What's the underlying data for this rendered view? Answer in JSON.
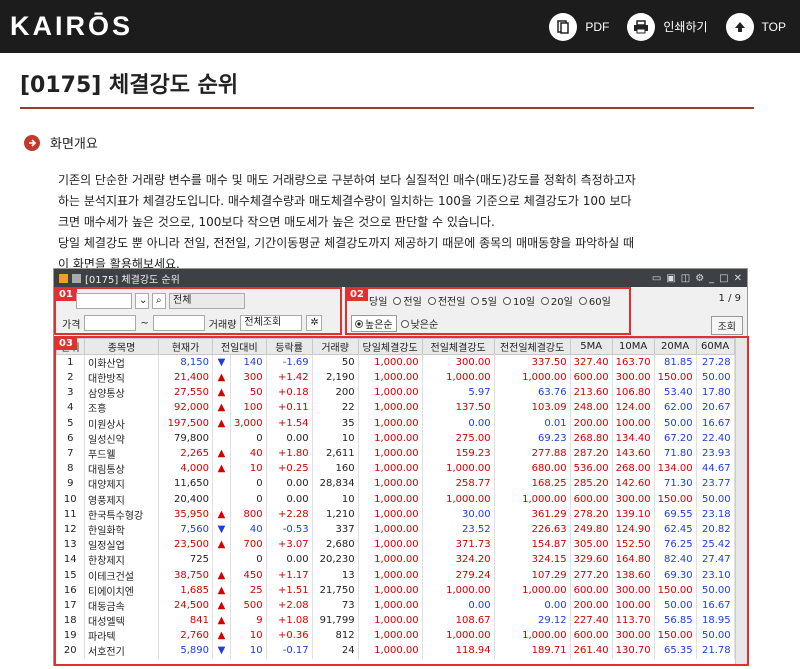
{
  "header": {
    "logo": "KAIRŌS",
    "pdf": "PDF",
    "print": "인쇄하기",
    "top": "TOP"
  },
  "page": {
    "title": "[0175] 체결강도 순위",
    "section": "화면개요",
    "desc": [
      "기존의 단순한 거래량 변수를 매수 및 매도 거래량으로 구분하여 보다 실질적인 매수(매도)강도를 정확히 측정하고자",
      "하는 분석지표가 체결강도입니다. 매수체결수량과 매도체결수량이 일치하는 100을 기준으로 체결강도가 100 보다",
      "크면 매수세가 높은 것으로, 100보다 작으면 매도세가 높은 것으로 판단할 수 있습니다.",
      "당일 체결강도 뿐 아니라 전일, 전전일, 기간이동평균 체결강도까지 제공하기 때문에 종목의 매매동향을 파악하실 때",
      "이 화면을 활용해보세요."
    ]
  },
  "window": {
    "title": "[0175] 체결강도 순위",
    "tags": [
      "01",
      "02",
      "03"
    ],
    "market": "전체",
    "price_label": "가격",
    "volume_label": "거래량",
    "volume_value": "전체조회",
    "radios": [
      "당일",
      "전일",
      "전전일",
      "5일",
      "10일",
      "20일",
      "60일"
    ],
    "sort": [
      "높은순",
      "낮은순"
    ],
    "pager": "1 / 9",
    "query": "조회"
  },
  "table": {
    "headers": [
      "순위",
      "종목명",
      "현재가",
      "전일대비",
      "",
      "등락률",
      "거래량",
      "당일체결강도",
      "전일체결강도",
      "전전일체결강도",
      "5MA",
      "10MA",
      "20MA",
      "60MA"
    ],
    "rows": [
      [
        "1",
        "이화산업",
        "8,150",
        "▼",
        "140",
        "-1.69",
        "50",
        "1,000.00",
        "300.00",
        "337.50",
        "327.40",
        "163.70",
        "81.85",
        "27.28"
      ],
      [
        "2",
        "대한방직",
        "21,400",
        "▲",
        "300",
        "+1.42",
        "2,190",
        "1,000.00",
        "1,000.00",
        "1,000.00",
        "600.00",
        "300.00",
        "150.00",
        "50.00"
      ],
      [
        "3",
        "삼양통상",
        "27,550",
        "▲",
        "50",
        "+0.18",
        "200",
        "1,000.00",
        "5.97",
        "63.76",
        "213.60",
        "106.80",
        "53.40",
        "17.80"
      ],
      [
        "4",
        "조흥",
        "92,000",
        "▲",
        "100",
        "+0.11",
        "22",
        "1,000.00",
        "137.50",
        "103.09",
        "248.00",
        "124.00",
        "62.00",
        "20.67"
      ],
      [
        "5",
        "미원상사",
        "197,500",
        "▲",
        "3,000",
        "+1.54",
        "35",
        "1,000.00",
        "0.00",
        "0.01",
        "200.00",
        "100.00",
        "50.00",
        "16.67"
      ],
      [
        "6",
        "일성신약",
        "79,800",
        "",
        "0",
        "0.00",
        "10",
        "1,000.00",
        "275.00",
        "69.23",
        "268.80",
        "134.40",
        "67.20",
        "22.40"
      ],
      [
        "7",
        "푸드웰",
        "2,265",
        "▲",
        "40",
        "+1.80",
        "2,611",
        "1,000.00",
        "159.23",
        "277.88",
        "287.20",
        "143.60",
        "71.80",
        "23.93"
      ],
      [
        "8",
        "대림통상",
        "4,000",
        "▲",
        "10",
        "+0.25",
        "160",
        "1,000.00",
        "1,000.00",
        "680.00",
        "536.00",
        "268.00",
        "134.00",
        "44.67"
      ],
      [
        "9",
        "대양제지",
        "11,650",
        "",
        "0",
        "0.00",
        "28,834",
        "1,000.00",
        "258.77",
        "168.25",
        "285.20",
        "142.60",
        "71.30",
        "23.77"
      ],
      [
        "10",
        "영풍제지",
        "20,400",
        "",
        "0",
        "0.00",
        "10",
        "1,000.00",
        "1,000.00",
        "1,000.00",
        "600.00",
        "300.00",
        "150.00",
        "50.00"
      ],
      [
        "11",
        "한국특수형강",
        "35,950",
        "▲",
        "800",
        "+2.28",
        "1,210",
        "1,000.00",
        "30.00",
        "361.29",
        "278.20",
        "139.10",
        "69.55",
        "23.18"
      ],
      [
        "12",
        "한일화학",
        "7,560",
        "▼",
        "40",
        "-0.53",
        "337",
        "1,000.00",
        "23.52",
        "226.63",
        "249.80",
        "124.90",
        "62.45",
        "20.82"
      ],
      [
        "13",
        "일정실업",
        "23,500",
        "▲",
        "700",
        "+3.07",
        "2,680",
        "1,000.00",
        "371.73",
        "154.87",
        "305.00",
        "152.50",
        "76.25",
        "25.42"
      ],
      [
        "14",
        "한창제지",
        "725",
        "",
        "0",
        "0.00",
        "20,230",
        "1,000.00",
        "324.20",
        "324.15",
        "329.60",
        "164.80",
        "82.40",
        "27.47"
      ],
      [
        "15",
        "이테크건설",
        "38,750",
        "▲",
        "450",
        "+1.17",
        "13",
        "1,000.00",
        "279.24",
        "107.29",
        "277.20",
        "138.60",
        "69.30",
        "23.10"
      ],
      [
        "16",
        "티에이치엔",
        "1,685",
        "▲",
        "25",
        "+1.51",
        "21,750",
        "1,000.00",
        "1,000.00",
        "1,000.00",
        "600.00",
        "300.00",
        "150.00",
        "50.00"
      ],
      [
        "17",
        "대동금속",
        "24,500",
        "▲",
        "500",
        "+2.08",
        "73",
        "1,000.00",
        "0.00",
        "0.00",
        "200.00",
        "100.00",
        "50.00",
        "16.67"
      ],
      [
        "18",
        "대성엘텍",
        "841",
        "▲",
        "9",
        "+1.08",
        "91,799",
        "1,000.00",
        "108.67",
        "29.12",
        "227.40",
        "113.70",
        "56.85",
        "18.95"
      ],
      [
        "19",
        "파라텍",
        "2,760",
        "▲",
        "10",
        "+0.36",
        "812",
        "1,000.00",
        "1,000.00",
        "1,000.00",
        "600.00",
        "300.00",
        "150.00",
        "50.00"
      ],
      [
        "20",
        "서호전기",
        "5,890",
        "▼",
        "10",
        "-0.17",
        "24",
        "1,000.00",
        "118.94",
        "189.71",
        "261.40",
        "130.70",
        "65.35",
        "21.78"
      ]
    ]
  },
  "colors": {
    "up": "#d40000",
    "down": "#1d3fd9",
    "accent": "#e03030"
  }
}
